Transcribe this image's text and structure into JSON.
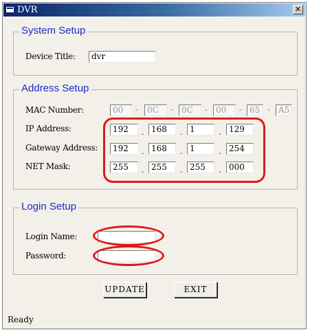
{
  "window": {
    "title": "DVR",
    "close_glyph": "✕"
  },
  "system_setup": {
    "legend": "System Setup",
    "device_title_label": "Device Title:",
    "device_title_value": "dvr"
  },
  "address_setup": {
    "legend": "Address Setup",
    "mac_label": "MAC Number:",
    "mac": [
      "00",
      "0C",
      "0C",
      "00",
      "65",
      "A5"
    ],
    "mac_separator": "-",
    "ip_label": "IP Address:",
    "ip": [
      "192",
      "168",
      "1",
      "129"
    ],
    "gateway_label": "Gateway Address:",
    "gateway": [
      "192",
      "168",
      "1",
      "254"
    ],
    "netmask_label": "NET Mask:",
    "netmask": [
      "255",
      "255",
      "255",
      "000"
    ],
    "octet_separator": "."
  },
  "login_setup": {
    "legend": "Login Setup",
    "login_name_label": "Login Name:",
    "login_name_value": "",
    "password_label": "Password:",
    "password_value": ""
  },
  "buttons": {
    "update": "UPDATE",
    "exit": "EXIT"
  },
  "status": "Ready",
  "colors": {
    "legend": "#1c2bc4",
    "callout": "#e01818",
    "titlebar_start": "#0a246a",
    "window_bg": "#f3f0e9"
  },
  "icons": {
    "app": "app-icon",
    "close": "close-icon"
  }
}
